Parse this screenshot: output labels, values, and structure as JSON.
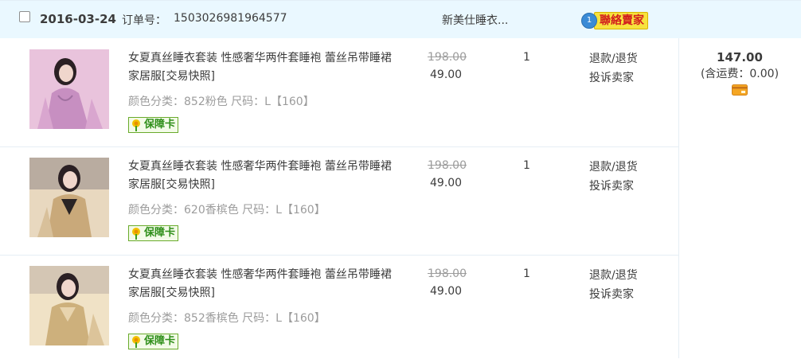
{
  "order": {
    "date": "2016-03-24",
    "order_no_label": "订单号：",
    "order_no": "1503026981964577",
    "shop_name": "新美仕睡衣...",
    "contact_badge": "1",
    "contact_label": "聯絡賣家"
  },
  "items": [
    {
      "title": "女夏真丝睡衣套装 性感奢华两件套睡袍 蕾丝吊带睡裙家居服[交易快照]",
      "spec": "颜色分类：852粉色  尺码：L【160】",
      "guarantee_label": "保障卡",
      "original_price": "198.00",
      "price": "49.00",
      "quantity": "1",
      "actions": [
        "退款/退货",
        "投诉卖家"
      ],
      "thumb_colors": [
        "#e9c3dc",
        "#c78fc1"
      ]
    },
    {
      "title": "女夏真丝睡衣套装 性感奢华两件套睡袍 蕾丝吊带睡裙家居服[交易快照]",
      "spec": "颜色分类：620香槟色  尺码：L【160】",
      "guarantee_label": "保障卡",
      "original_price": "198.00",
      "price": "49.00",
      "quantity": "1",
      "actions": [
        "退款/退货",
        "投诉卖家"
      ],
      "thumb_colors": [
        "#e8d8bf",
        "#c9a97a"
      ]
    },
    {
      "title": "女夏真丝睡衣套装 性感奢华两件套睡袍 蕾丝吊带睡裙家居服[交易快照]",
      "spec": "颜色分类：852香槟色  尺码：L【160】",
      "guarantee_label": "保障卡",
      "original_price": "198.00",
      "price": "49.00",
      "quantity": "1",
      "actions": [
        "退款/退货",
        "投诉卖家"
      ],
      "thumb_colors": [
        "#f0e2c6",
        "#cdb07c"
      ]
    }
  ],
  "total": {
    "amount": "147.00",
    "shipping": "(含运费：0.00)"
  },
  "colors": {
    "header_bg": "#eaf8ff",
    "contact_bg": "#f7e23d",
    "contact_text": "#d21e1e",
    "guarantee_green": "#2f8f1a"
  }
}
